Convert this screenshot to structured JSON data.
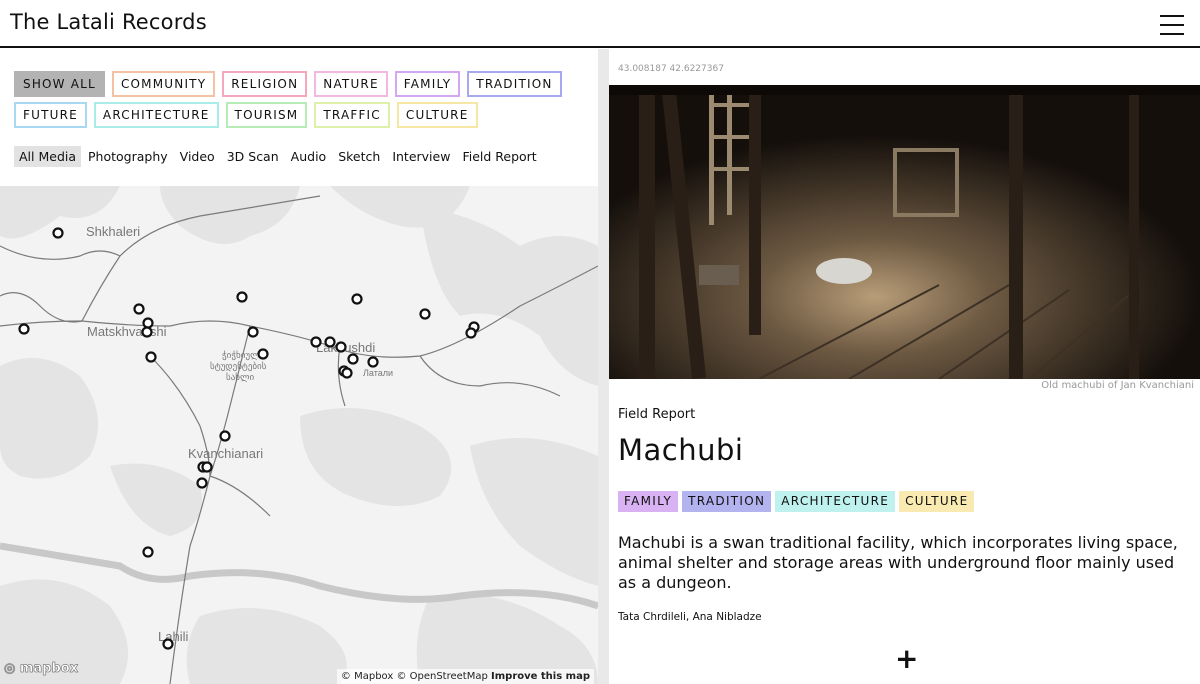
{
  "site": {
    "title": "The Latali Records"
  },
  "filters": {
    "topics": [
      {
        "label": "SHOW ALL",
        "color": "#b3b3b3",
        "active": true
      },
      {
        "label": "COMMUNITY",
        "color": "#f3c2a5"
      },
      {
        "label": "RELIGION",
        "color": "#f4a7bd"
      },
      {
        "label": "NATURE",
        "color": "#f2b9e0"
      },
      {
        "label": "FAMILY",
        "color": "#d4a7f0"
      },
      {
        "label": "TRADITION",
        "color": "#a8a8ee"
      },
      {
        "label": "FUTURE",
        "color": "#a9d9f2"
      },
      {
        "label": "ARCHITECTURE",
        "color": "#a9ece8"
      },
      {
        "label": "TOURISM",
        "color": "#b6ecb6"
      },
      {
        "label": "TRAFFIC",
        "color": "#dff0a8"
      },
      {
        "label": "CULTURE",
        "color": "#f6e7a4"
      }
    ],
    "media": [
      "All Media",
      "Photography",
      "Video",
      "3D Scan",
      "Audio",
      "Sketch",
      "Interview",
      "Field Report"
    ]
  },
  "map": {
    "places": [
      "Shkhaleri",
      "Matskhvarishi",
      "Lakhushdi",
      "Kvanchianari",
      "Lahili"
    ],
    "local_labels": [
      "ჭიჭხიული",
      "სტუდენტების",
      "სახლი",
      "Латали"
    ],
    "logo": "mapbox",
    "attribution": {
      "text": "© Mapbox © OpenStreetMap",
      "link": "Improve this map"
    }
  },
  "entry": {
    "coords": "43.008187 42.6227367",
    "caption": "Old machubi of Jan Kvanchiani",
    "media_type": "Field Report",
    "title": "Machubi",
    "tags": [
      {
        "label": "FAMILY",
        "color": "#d9b2f3"
      },
      {
        "label": "TRADITION",
        "color": "#b3b3f0"
      },
      {
        "label": "ARCHITECTURE",
        "color": "#bff2ee"
      },
      {
        "label": "CULTURE",
        "color": "#f8eab0"
      }
    ],
    "description": "Machubi is a swan traditional facility, which incorporates living space, animal shelter and storage areas with underground floor mainly used as a dungeon.",
    "authors": "Tata Chrdileli, Ana Nibladze",
    "expand_label": "+"
  }
}
